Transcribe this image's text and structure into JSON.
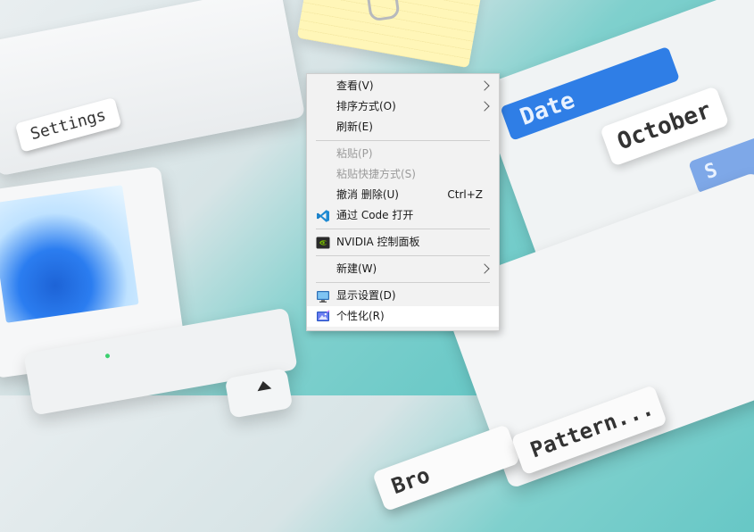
{
  "wallpaper": {
    "settings_label": "Settings",
    "date_label": "Date",
    "october_label": "October",
    "small_label": "S",
    "button1_label": "Bro",
    "button2_label": "Pattern..."
  },
  "context_menu": {
    "items": [
      {
        "label": "查看(V)",
        "submenu": true,
        "icon": "none"
      },
      {
        "label": "排序方式(O)",
        "submenu": true,
        "icon": "none"
      },
      {
        "label": "刷新(E)",
        "submenu": false,
        "icon": "none"
      },
      {
        "label": "粘贴(P)",
        "submenu": false,
        "disabled": true,
        "icon": "none"
      },
      {
        "label": "粘贴快捷方式(S)",
        "submenu": false,
        "disabled": true,
        "icon": "none"
      },
      {
        "label": "撤消 删除(U)",
        "shortcut": "Ctrl+Z",
        "icon": "none"
      },
      {
        "label": "通过 Code 打开",
        "icon": "vscode-icon"
      },
      {
        "label": "NVIDIA 控制面板",
        "icon": "nvidia-icon"
      },
      {
        "label": "新建(W)",
        "submenu": true,
        "icon": "none"
      },
      {
        "label": "显示设置(D)",
        "icon": "display-settings-icon"
      },
      {
        "label": "个性化(R)",
        "icon": "personalize-icon",
        "highlighted": true
      }
    ]
  },
  "colors": {
    "vscode_blue": "#1f8ad2",
    "nvidia_green": "#76b900",
    "menu_bg": "#f2f2f2"
  }
}
